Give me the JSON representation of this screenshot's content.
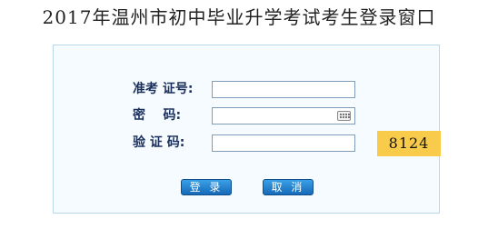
{
  "page": {
    "title": "2017年温州市初中毕业升学考试考生登录窗口"
  },
  "form": {
    "id_label": "准考 证号:",
    "password_label": "密    码:",
    "captcha_label": "验 证 码:",
    "id_value": "",
    "password_value": "",
    "captcha_value": "",
    "captcha_code": "8124"
  },
  "buttons": {
    "login": "登 录",
    "cancel": "取 消"
  },
  "colors": {
    "label": "#1a2f5c",
    "panel_bg": "#f5fbfe",
    "captcha_bg": "#f8cc4a",
    "button": "#1a7dd0"
  },
  "icons": {
    "password_field_icon": "keyboard-icon"
  }
}
